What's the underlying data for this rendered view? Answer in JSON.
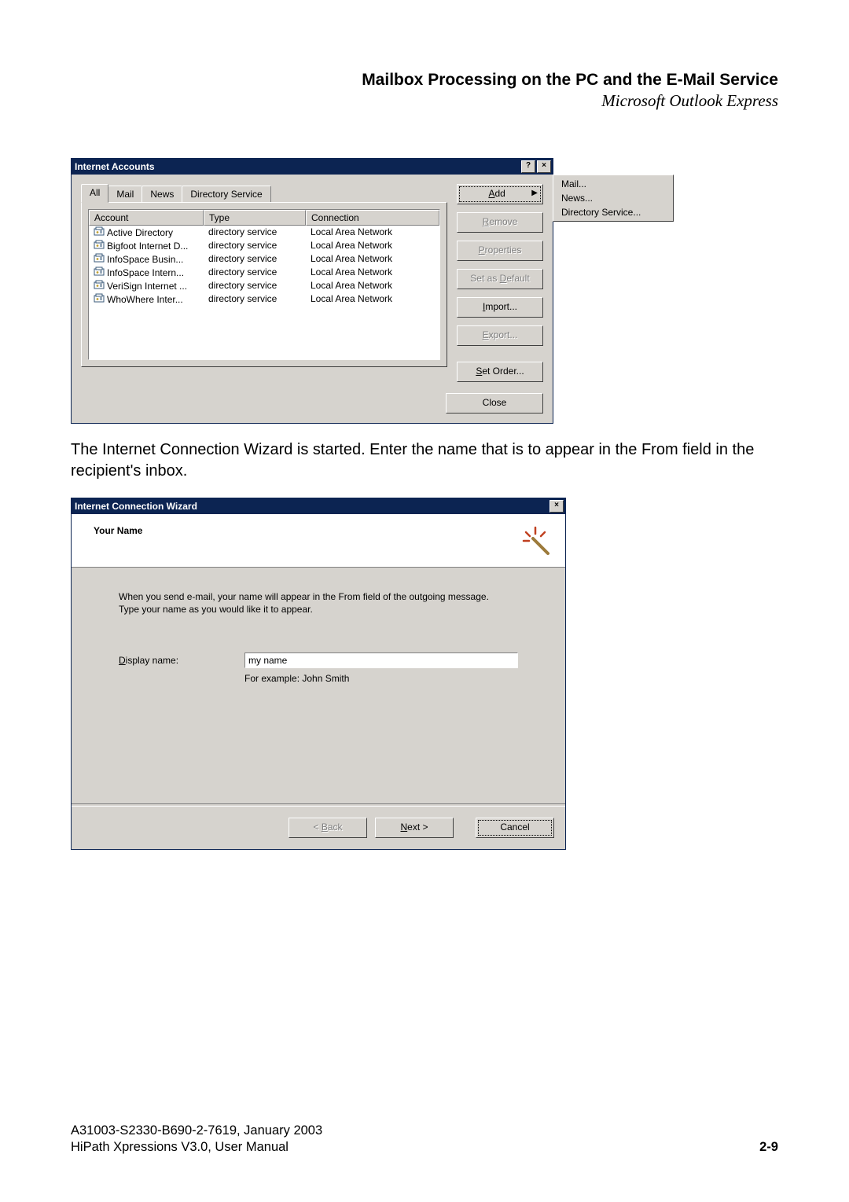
{
  "header": {
    "title": "Mailbox Processing on the PC and the E-Mail Service",
    "subtitle": "Microsoft Outlook Express"
  },
  "ia": {
    "window_title": "Internet Accounts",
    "tabs": [
      "All",
      "Mail",
      "News",
      "Directory Service"
    ],
    "columns": {
      "account": "Account",
      "type": "Type",
      "connection": "Connection"
    },
    "rows": [
      {
        "account": "Active Directory",
        "type": "directory service",
        "connection": "Local Area Network"
      },
      {
        "account": "Bigfoot Internet D...",
        "type": "directory service",
        "connection": "Local Area Network"
      },
      {
        "account": "InfoSpace Busin...",
        "type": "directory service",
        "connection": "Local Area Network"
      },
      {
        "account": "InfoSpace Intern...",
        "type": "directory service",
        "connection": "Local Area Network"
      },
      {
        "account": "VeriSign Internet ...",
        "type": "directory service",
        "connection": "Local Area Network"
      },
      {
        "account": "WhoWhere Inter...",
        "type": "directory service",
        "connection": "Local Area Network"
      }
    ],
    "buttons": {
      "add": "Add",
      "remove": "Remove",
      "properties": "Properties",
      "set_default": "Set as Default",
      "import": "Import...",
      "export": "Export...",
      "set_order": "Set Order...",
      "close": "Close"
    },
    "submenu": {
      "mail": "Mail...",
      "news": "News...",
      "dirsvc": "Directory Service..."
    }
  },
  "paragraph": "The Internet Connection Wizard is started. Enter the name that is to appear in the From field in the recipient's inbox.",
  "wiz": {
    "window_title": "Internet Connection Wizard",
    "heading": "Your Name",
    "desc1": "When you send e-mail, your name will appear in the From field of the outgoing message.",
    "desc2": "Type your name as you would like it to appear.",
    "display_label": "Display name:",
    "display_value": "my name",
    "example": "For example: John Smith",
    "back": "< Back",
    "next": "Next >",
    "cancel": "Cancel"
  },
  "footer": {
    "line1": "A31003-S2330-B690-2-7619, January 2003",
    "line2": "HiPath Xpressions V3.0, User Manual",
    "page": "2-9"
  }
}
